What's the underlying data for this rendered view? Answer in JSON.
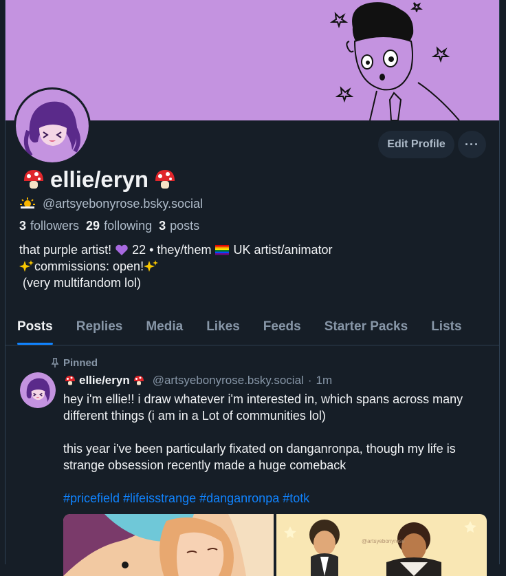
{
  "profile": {
    "display_name": "ellie/eryn",
    "name_emoji": "mushroom",
    "handle": "@artsyebonyrose.bsky.social",
    "handle_icon": "sun-behind-cloud-icon",
    "edit_profile_label": "Edit Profile",
    "more_label": "···",
    "stats": {
      "followers_count": "3",
      "followers_label": "followers",
      "following_count": "29",
      "following_label": "following",
      "posts_count": "3",
      "posts_label": "posts"
    },
    "bio": {
      "line1_a": "that purple artist! ",
      "line1_b": " 22 • they/them ",
      "line1_c": " UK artist/animator",
      "line2_a": "commissions: open!",
      "line3": " (very multifandom lol)"
    }
  },
  "tabs": [
    {
      "label": "Posts"
    },
    {
      "label": "Replies"
    },
    {
      "label": "Media"
    },
    {
      "label": "Likes"
    },
    {
      "label": "Feeds"
    },
    {
      "label": "Starter Packs"
    },
    {
      "label": "Lists"
    }
  ],
  "post": {
    "pinned_label": "Pinned",
    "author_name": "ellie/eryn",
    "author_handle": "@artsyebonyrose.bsky.social",
    "separator": "·",
    "time": "1m",
    "para1": "hey i'm ellie!! i draw whatever i'm interested in, which spans across many different things (i am in a Lot of communities lol)",
    "para2": "this year i've been particularly fixated on danganronpa, though my life is strange obsession recently made a huge comeback",
    "tags": "#pricefield #lifeisstrange #danganronpa #totk",
    "image_watermark": "@artsyebonyrose"
  },
  "colors": {
    "background": "#161e27",
    "banner": "#c493e0",
    "accent": "#1083fe",
    "muted": "#8796a7"
  }
}
